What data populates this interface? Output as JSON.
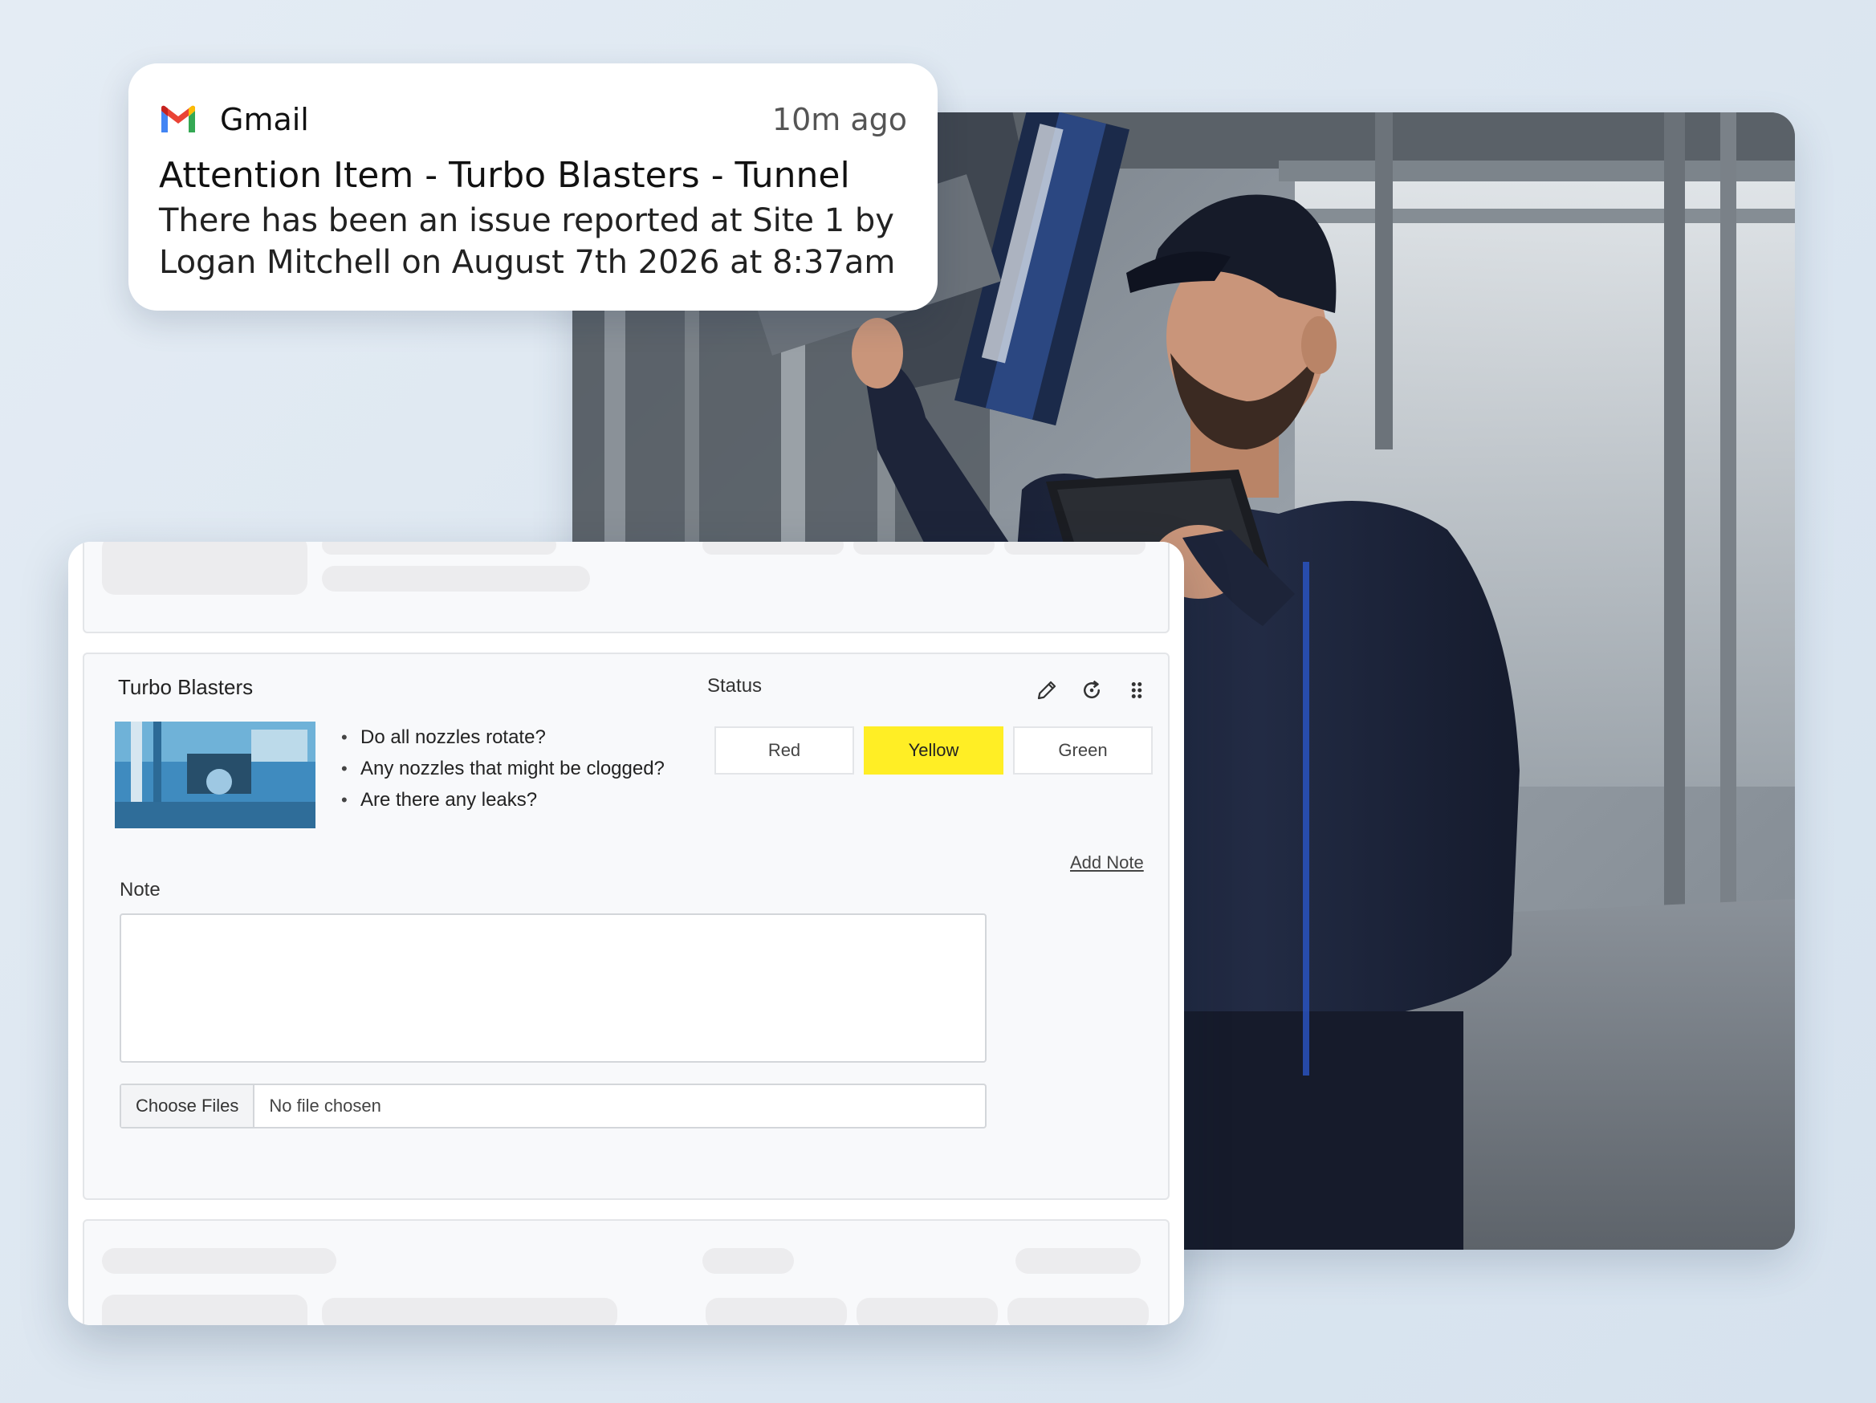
{
  "notification": {
    "app_name": "Gmail",
    "time": "10m ago",
    "title": "Attention Item - Turbo Blasters - Tunnel",
    "body_line1": "There has been an issue reported at Site 1 by",
    "body_line2": "Logan Mitchell on August 7th 2026 at 8:37am"
  },
  "inspection": {
    "title": "Turbo Blasters",
    "status_label": "Status",
    "checklist": [
      "Do all nozzles rotate?",
      "Any nozzles that might be clogged?",
      "Are there any leaks?"
    ],
    "status_options": [
      "Red",
      "Yellow",
      "Green"
    ],
    "selected_status": "Yellow",
    "add_note_label": "Add Note",
    "note_label": "Note",
    "note_value": "",
    "file_button_label": "Choose Files",
    "file_status": "No file chosen"
  },
  "colors": {
    "selected_status": "#ffee25",
    "gmail_red": "#ea4335",
    "gmail_blue": "#4285f4",
    "gmail_green": "#34a853",
    "gmail_yellow": "#fbbc04"
  },
  "icons": {
    "notification_app": "gmail-logo-icon",
    "edit": "pencil-icon",
    "reset": "refresh-icon",
    "drag": "drag-handle-icon"
  }
}
